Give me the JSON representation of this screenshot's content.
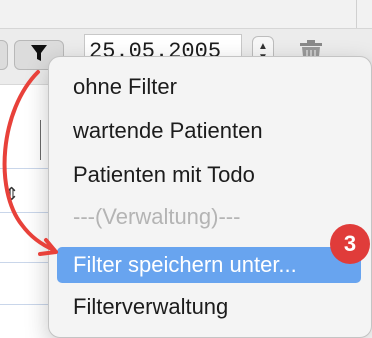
{
  "toolbar": {
    "date_value": "25.05.2005",
    "stepper_up": "▲",
    "stepper_down": "▼"
  },
  "list": {
    "sort_glyph": "⇕"
  },
  "filter_menu": {
    "items": [
      {
        "label": "ohne Filter",
        "state": "normal"
      },
      {
        "label": "wartende Patienten",
        "state": "normal"
      },
      {
        "label": "Patienten mit Todo",
        "state": "normal"
      },
      {
        "label": "---(Verwaltung)---",
        "state": "disabled"
      },
      {
        "label": "Filter speichern unter...",
        "state": "selected"
      },
      {
        "label": "Filterverwaltung",
        "state": "normal"
      }
    ]
  },
  "annotation": {
    "step_number": "3",
    "badge_color": "#e03c3a",
    "arrow_color": "#e8413a"
  },
  "colors": {
    "selection": "#68a4ef",
    "menu_background": "#f4f4f4"
  },
  "icons": [
    "filter-funnel-icon",
    "trash-icon",
    "stepper-icon",
    "sort-arrows-icon",
    "callout-arrow-icon"
  ]
}
